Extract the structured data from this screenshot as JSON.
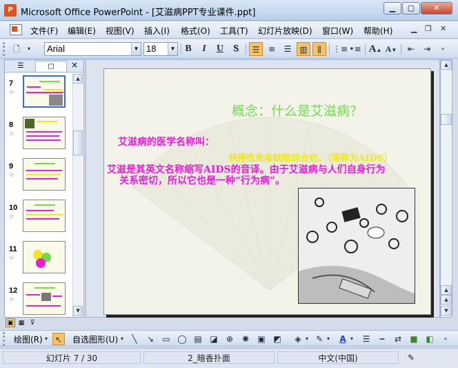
{
  "window": {
    "title": "Microsoft Office PowerPoint - [艾滋病PPT专业课件.ppt]",
    "app_icon": "P",
    "controls": {
      "minimize": "▁",
      "maximize": "▢",
      "close": "✕"
    }
  },
  "menu": {
    "items": [
      "文件(F)",
      "编辑(E)",
      "视图(V)",
      "插入(I)",
      "格式(O)",
      "工具(T)",
      "幻灯片放映(D)",
      "窗口(W)",
      "帮助(H)"
    ]
  },
  "toolbar": {
    "font_name": "Arial",
    "font_size": "18",
    "bold": "B",
    "italic": "I",
    "underline": "U",
    "shadow": "S",
    "increase_font": "A",
    "decrease_font": "A"
  },
  "left_pane": {
    "close": "×",
    "slides": [
      {
        "number": "7",
        "selected": true
      },
      {
        "number": "8"
      },
      {
        "number": "9"
      },
      {
        "number": "10"
      },
      {
        "number": "11"
      },
      {
        "number": "12"
      }
    ]
  },
  "slide": {
    "title": "概念：什么是艾滋病？",
    "line1": "艾滋病的医学名称叫：",
    "line2": "获得性免疫缺陷综合症。（简称为AIDS）",
    "line3a": "艾滋是其英文名称缩写AIDS的音译。由于艾滋病与人们自身行为",
    "line3b": "关系密切，所以它也是一种“行为病”。",
    "colors": {
      "title": "#6fdc4e",
      "body": "#e61fd7",
      "highlight": "#f0e81a"
    }
  },
  "drawing_toolbar": {
    "draw_label": "绘图(R)",
    "autoshapes_label": "自选图形(U)"
  },
  "status": {
    "slide_info": "幻灯片 7 / 30",
    "design": "2_暗香扑面",
    "language": "中文(中国)"
  }
}
